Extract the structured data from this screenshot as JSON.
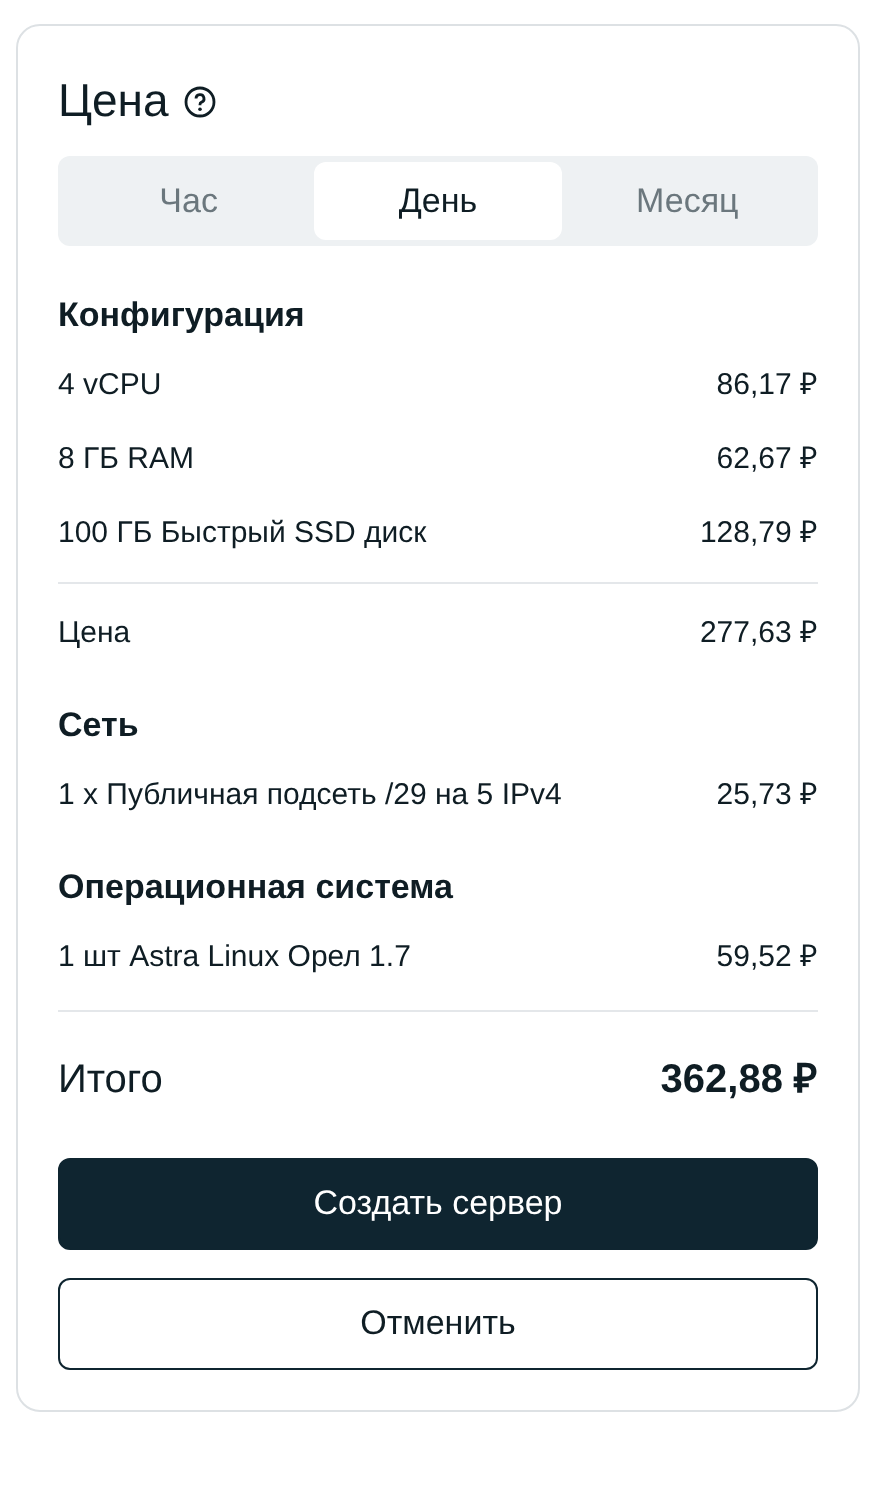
{
  "title": "Цена",
  "tabs": [
    {
      "label": "Час",
      "selected": false
    },
    {
      "label": "День",
      "selected": true
    },
    {
      "label": "Месяц",
      "selected": false
    }
  ],
  "sections": [
    {
      "heading": "Конфигурация",
      "lines": [
        {
          "label": "4 vCPU",
          "price": "86,17 ₽"
        },
        {
          "label": "8 ГБ RAM",
          "price": "62,67 ₽"
        },
        {
          "label": "100 ГБ Быстрый SSD диск",
          "price": "128,79 ₽"
        }
      ],
      "subtotal": {
        "label": "Цена",
        "price": "277,63 ₽"
      }
    },
    {
      "heading": "Сеть",
      "lines": [
        {
          "label": "1 x Публичная подсеть /29 на 5 IPv4",
          "price": "25,73 ₽"
        }
      ]
    },
    {
      "heading": "Операционная система",
      "lines": [
        {
          "label": "1 шт Astra Linux Орел 1.7",
          "price": "59,52 ₽"
        }
      ]
    }
  ],
  "total": {
    "label": "Итого",
    "price": "362,88 ₽"
  },
  "buttons": [
    {
      "label": "Создать сервер",
      "kind": "primary"
    },
    {
      "label": "Отменить",
      "kind": "secondary"
    }
  ]
}
